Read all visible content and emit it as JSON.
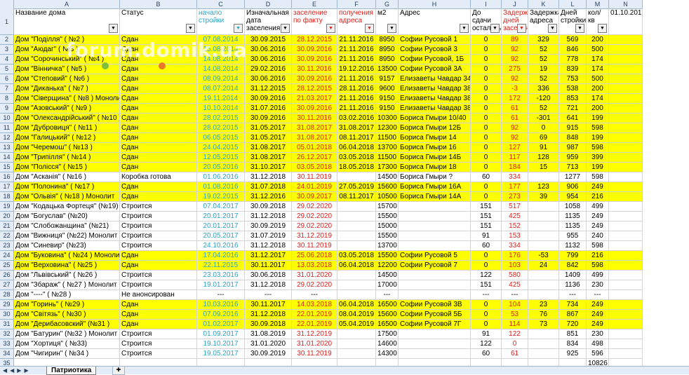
{
  "column_letters": [
    "A",
    "B",
    "C",
    "D",
    "E",
    "F",
    "G",
    "H",
    "I",
    "J",
    "K",
    "L",
    "M",
    "N"
  ],
  "headers": [
    {
      "text": "Название дома",
      "filter": true,
      "color": ""
    },
    {
      "text": "Статус",
      "filter": true,
      "color": ""
    },
    {
      "text": "начало стройки",
      "filter": true,
      "color": "blue"
    },
    {
      "text": "Изначальная дата заселения",
      "filter": true,
      "color": ""
    },
    {
      "text": "заселение по факту",
      "filter": true,
      "color": "red"
    },
    {
      "text": "получения адреса",
      "filter": true,
      "color": "red"
    },
    {
      "text": "м2",
      "filter": true,
      "color": ""
    },
    {
      "text": "Адрес",
      "filter": true,
      "color": ""
    },
    {
      "text": "До сдачи осталось",
      "filter": true,
      "color": ""
    },
    {
      "text": "Задержка дней заселения",
      "filter": true,
      "color": "red"
    },
    {
      "text": "Задержка адреса",
      "filter": true,
      "color": ""
    },
    {
      "text": "Дней стройки",
      "filter": true,
      "color": ""
    },
    {
      "text": "кол/кв",
      "filter": true,
      "color": ""
    },
    {
      "text": "01.10.2019",
      "filter": false,
      "color": ""
    }
  ],
  "rows": [
    {
      "n": "2",
      "y": true,
      "c": [
        "Дом \"Поділля\" ( №2 )",
        "Сдан",
        "07.08.2014",
        "30.09.2015",
        "28.12.2015",
        "21.11.2016",
        "8950",
        "Софии Русовой 1",
        "0",
        "89",
        "329",
        "569",
        "200",
        ""
      ]
    },
    {
      "n": "3",
      "y": true,
      "c": [
        "Дом \"Аюдаг\" ( №3 )",
        "Сдан",
        "15.08.2014",
        "30.06.2016",
        "30.09.2016",
        "21.11.2016",
        "8950",
        "Софии Русовой 3",
        "0",
        "92",
        "52",
        "846",
        "500",
        ""
      ]
    },
    {
      "n": "4",
      "y": true,
      "c": [
        "Дом \"Сорочинський\" ( №4 )",
        "Сдан",
        "14.08.2014",
        "30.06.2016",
        "30.09.2016",
        "21.11.2016",
        "8950",
        "Софии Русовой, 1Б",
        "0",
        "92",
        "52",
        "778",
        "174",
        ""
      ]
    },
    {
      "n": "5",
      "y": true,
      "c": [
        "Дом \"Вінничка\" ( №5 )",
        "Сдан",
        "14.08.2014",
        "29.02.2016",
        "30.11.2016",
        "19.12.2016",
        "13500",
        "Софии Русовой 3А",
        "0",
        "275",
        "19",
        "839",
        "174",
        ""
      ]
    },
    {
      "n": "6",
      "y": true,
      "c": [
        "Дом \"Степовий\" ( №6 )",
        "Сдан",
        "08.09.2014",
        "30.06.2016",
        "30.09.2016",
        "21.11.2016",
        "9157",
        "Елизаветы Чавдар 34",
        "0",
        "92",
        "52",
        "753",
        "500",
        ""
      ]
    },
    {
      "n": "7",
      "y": true,
      "c": [
        "Дом \"Диканька\" ( №7 )",
        "Сдан",
        "08.07.2014",
        "31.12.2015",
        "28.12.2015",
        "28.11.2016",
        "9600",
        "Елизаветы Чавдар 38",
        "0",
        "-3",
        "336",
        "538",
        "200",
        ""
      ]
    },
    {
      "n": "8",
      "y": true,
      "c": [
        "Дом \"Сіверщина\" ( №8 ) Монолит",
        "Сдан",
        "19.11.2014",
        "30.09.2016",
        "21.03.2017",
        "21.11.2016",
        "9150",
        "Елизаветы Чавдар 38А",
        "0",
        "172",
        "-120",
        "853",
        "174",
        ""
      ]
    },
    {
      "n": "9",
      "y": true,
      "c": [
        "Дом \"Азовський\" ( №9 )",
        "Сдан",
        "10.10.2014",
        "31.07.2016",
        "30.09.2016",
        "21.11.2016",
        "9150",
        "Елизаветы Чавдар 38Б",
        "0",
        "61",
        "52",
        "721",
        "200",
        ""
      ]
    },
    {
      "n": "10",
      "y": true,
      "c": [
        "Дом \"Олександрійський\" ( №10 )",
        "Сдан",
        "28.02.2015",
        "30.09.2016",
        "30.11.2016",
        "03.02.2016",
        "10300",
        "Бориса Гмыри 10/40",
        "0",
        "61",
        "-301",
        "641",
        "199",
        ""
      ]
    },
    {
      "n": "11",
      "y": true,
      "c": [
        "Дом \"Дубровиця\" ( №11 )",
        "Сдан",
        "28.02.2015",
        "31.05.2017",
        "31.08.2017",
        "31.08.2017",
        "12300",
        "Бориса Гмыри 12Б",
        "0",
        "92",
        "0",
        "915",
        "598",
        ""
      ]
    },
    {
      "n": "12",
      "y": true,
      "c": [
        "Дом \"Галицький\" ( №12 )",
        "Сдан",
        "06.05.2015",
        "31.05.2017",
        "31.08.2017",
        "08.11.2017",
        "11500",
        "Бориса Гмыри 14",
        "0",
        "92",
        "69",
        "848",
        "199",
        ""
      ]
    },
    {
      "n": "13",
      "y": true,
      "c": [
        "Дом \"Черемош\" ( №13 )",
        "Сдан",
        "24.04.2015",
        "31.08.2017",
        "05.01.2018",
        "06.04.2018",
        "13700",
        "Бориса Гмыри 16",
        "0",
        "127",
        "91",
        "987",
        "598",
        ""
      ]
    },
    {
      "n": "14",
      "y": true,
      "c": [
        "Дом \"Трипілля\" ( №14 )",
        "Сдан",
        "12.05.2015",
        "31.08.2017",
        "26.12.2017",
        "03.05.2018",
        "11500",
        "Бориса Гмыри 14Б",
        "0",
        "117",
        "128",
        "959",
        "399",
        ""
      ]
    },
    {
      "n": "15",
      "y": true,
      "c": [
        "Дом \"Полісся\" ( №15 )",
        "Сдан",
        "20.05.2016",
        "31.10.2017",
        "03.05.2018",
        "18.05.2018",
        "17300",
        "Бориса Гмыри 18",
        "0",
        "184",
        "15",
        "713",
        "199",
        ""
      ]
    },
    {
      "n": "16",
      "y": false,
      "c": [
        "Дом \"Асканія\" ( №16 )",
        "Коробка готова",
        "01.06.2016",
        "31.12.2018",
        "30.11.2019",
        "",
        "14500",
        "Бориса Гмыри ?",
        "60",
        "334",
        "",
        "1277",
        "598",
        ""
      ]
    },
    {
      "n": "17",
      "y": true,
      "c": [
        "Дом \"Полонина\" ( №17 )",
        "Сдан",
        "01.08.2016",
        "31.07.2018",
        "24.01.2019",
        "27.05.2019",
        "15600",
        "Бориса Гмыри 16А",
        "0",
        "177",
        "123",
        "906",
        "249",
        ""
      ]
    },
    {
      "n": "18",
      "y": true,
      "c": [
        "Дом \"Ольвія\" ( №18 ) Монолит",
        "Сдан",
        "19.02.2015",
        "31.12.2016",
        "30.09.2017",
        "08.11.2017",
        "10500",
        "Бориса Гмыри 14А",
        "0",
        "273",
        "39",
        "954",
        "216",
        ""
      ]
    },
    {
      "n": "19",
      "y": false,
      "c": [
        "Дом \"Кодацька Фортеця\" (№19)",
        "Строится",
        "07.04.2017",
        "30.09.2018",
        "29.02.2020",
        "",
        "15700",
        "",
        "151",
        "517",
        "",
        "1058",
        "499",
        ""
      ]
    },
    {
      "n": "20",
      "y": false,
      "c": [
        "Дом \"Богуслав\" (№20)",
        "Строится",
        "20.01.2017",
        "31.12.2018",
        "29.02.2020",
        "",
        "15500",
        "",
        "151",
        "425",
        "",
        "1135",
        "249",
        ""
      ]
    },
    {
      "n": "21",
      "y": false,
      "c": [
        "Дом \"Слобожанщина\" (№21)",
        "Строится",
        "20.01.2017",
        "30.09.2019",
        "29.02.2020",
        "",
        "15000",
        "",
        "151",
        "152",
        "",
        "1135",
        "249",
        ""
      ]
    },
    {
      "n": "22",
      "y": false,
      "c": [
        "Дом \"Вижниця\" (№22) Монолит",
        "Строится",
        "20.05.2017",
        "31.07.2019",
        "31.12.2019",
        "",
        "15500",
        "",
        "91",
        "153",
        "",
        "955",
        "240",
        ""
      ]
    },
    {
      "n": "23",
      "y": false,
      "c": [
        "Дом \"Синевир\" (№23)",
        "Строится",
        "24.10.2016",
        "31.12.2018",
        "30.11.2019",
        "",
        "13700",
        "",
        "60",
        "334",
        "",
        "1132",
        "598",
        ""
      ]
    },
    {
      "n": "24",
      "y": true,
      "c": [
        "Дом \"Буковина\" ( №24 ) Монолит",
        "Сдан",
        "17.04.2016",
        "31.12.2017",
        "25.06.2018",
        "03.05.2018",
        "15500",
        "Софии Русовой 5",
        "0",
        "176",
        "-53",
        "799",
        "216",
        ""
      ]
    },
    {
      "n": "25",
      "y": true,
      "c": [
        "Дом \"Верховина\" ( №25 )",
        "Сдан",
        "22.11.2015",
        "30.11.2017",
        "13.03.2018",
        "06.04.2018",
        "12200",
        "Софии Русовой 7",
        "0",
        "103",
        "24",
        "842",
        "598",
        ""
      ]
    },
    {
      "n": "26",
      "y": false,
      "c": [
        "Дом \"Львівський\" ( №26 )",
        "Строится",
        "23.03.2016",
        "30.06.2018",
        "31.01.2020",
        "",
        "14500",
        "",
        "122",
        "580",
        "",
        "1409",
        "499",
        ""
      ]
    },
    {
      "n": "27",
      "y": false,
      "c": [
        "Дом \"Збараж\" ( №27 ) Монолит",
        "Строится",
        "19.01.2017",
        "31.12.2018",
        "29.02.2020",
        "",
        "17000",
        "",
        "151",
        "425",
        "",
        "1136",
        "230",
        ""
      ]
    },
    {
      "n": "28",
      "y": false,
      "c": [
        "Дом \"----\" ( №28 )",
        "Не анонсирован",
        "---",
        "---",
        "---",
        "",
        "---",
        "",
        "---",
        "---",
        "",
        "---",
        "---",
        ""
      ]
    },
    {
      "n": "29",
      "y": true,
      "c": [
        "Дом \"Горинь\" ( №29 )",
        "Сдан",
        "10.03.2016",
        "30.11.2017",
        "14.03.2018",
        "06.04.2018",
        "16500",
        "Софии Русовой 3В",
        "0",
        "104",
        "23",
        "734",
        "249",
        ""
      ]
    },
    {
      "n": "30",
      "y": true,
      "c": [
        "Дом \"Світязь\" ( №30 )",
        "Сдан",
        "07.09.2016",
        "31.12.2018",
        "22.01.2019",
        "08.04.2019",
        "15600",
        "Софии Русовой 5Б",
        "0",
        "53",
        "76",
        "867",
        "249",
        ""
      ]
    },
    {
      "n": "31",
      "y": true,
      "c": [
        "Дом \"Дерибасовский\" (№31 )",
        "Сдан",
        "01.02.2017",
        "30.09.2018",
        "22.01.2019",
        "05.04.2019",
        "16500",
        "Софии Русовой 7Г",
        "0",
        "114",
        "73",
        "720",
        "249",
        ""
      ]
    },
    {
      "n": "32",
      "y": false,
      "c": [
        "Дом \"Батурин\" (№32 ) Монолит",
        "Строится",
        "01.09.2017",
        "31.08.2019",
        "31.12.2019",
        "",
        "17500",
        "",
        "91",
        "122",
        "",
        "851",
        "230",
        ""
      ]
    },
    {
      "n": "33",
      "y": false,
      "c": [
        "Дом \"Хортиця\" ( №33)",
        "Строится",
        "19.10.2017",
        "31.01.2020",
        "31.01.2020",
        "",
        "14600",
        "",
        "122",
        "0",
        "",
        "834",
        "498",
        ""
      ]
    },
    {
      "n": "34",
      "y": false,
      "c": [
        "Дом \"Чигирин\" ( №34 )",
        "Строится",
        "19.05.2017",
        "30.09.2019",
        "30.11.2019",
        "",
        "14300",
        "",
        "60",
        "61",
        "",
        "925",
        "596",
        ""
      ]
    },
    {
      "n": "35",
      "y": false,
      "c": [
        "",
        "",
        "",
        "",
        "",
        "",
        "",
        "",
        "",
        "",
        "",
        "",
        "10826",
        ""
      ]
    }
  ],
  "sheet_tab": "Патриотика",
  "watermark": "forum.domik.ua"
}
